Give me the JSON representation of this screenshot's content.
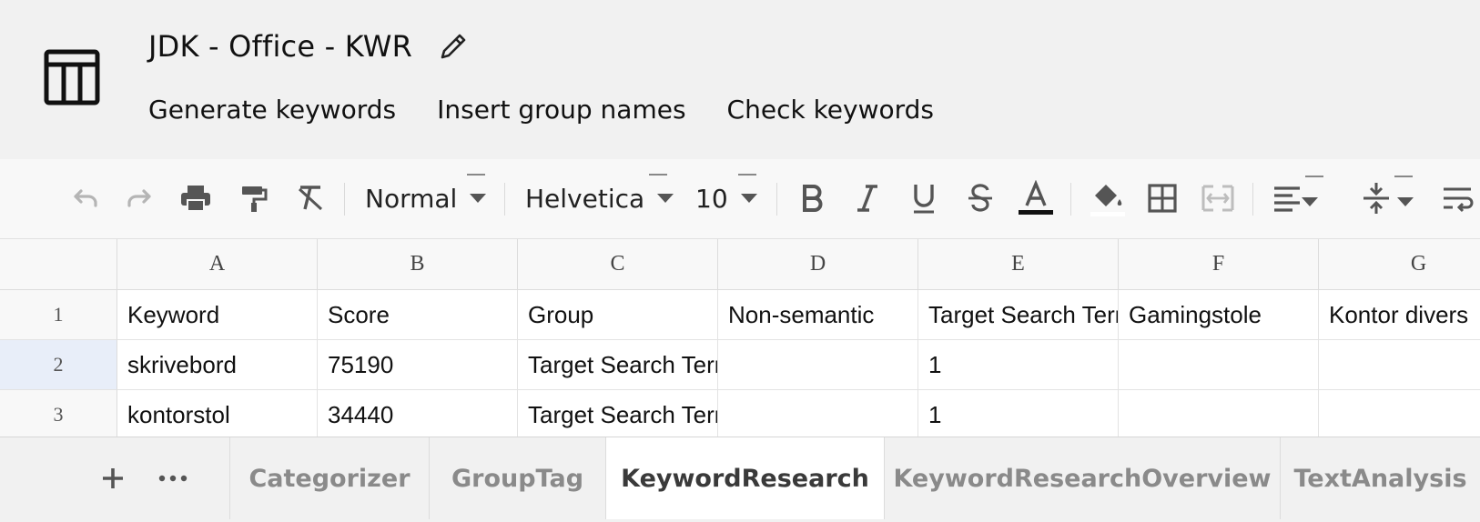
{
  "header": {
    "title": "JDK - Office - KWR",
    "menu": [
      "Generate keywords",
      "Insert group names",
      "Check keywords"
    ]
  },
  "toolbar": {
    "style": "Normal",
    "font": "Helvetica",
    "size": "10",
    "icons": [
      "undo-icon",
      "redo-icon",
      "print-icon",
      "paint-format-icon",
      "clear-format-icon",
      "bold-icon",
      "italic-icon",
      "underline-icon",
      "strikethrough-icon",
      "text-color-icon",
      "fill-color-icon",
      "borders-icon",
      "merge-cells-icon",
      "align-left-icon",
      "vertical-align-icon",
      "wrap-text-icon"
    ]
  },
  "grid": {
    "columns": [
      "A",
      "B",
      "C",
      "D",
      "E",
      "F",
      "G"
    ],
    "rows": [
      {
        "num": "1",
        "cells": [
          "Keyword",
          "Score",
          "Group",
          "Non-semantic",
          "Target Search Terms",
          "Gamingstole",
          "Kontor divers"
        ]
      },
      {
        "num": "2",
        "cells": [
          "skrivebord",
          "75190",
          "Target Search Terms",
          "",
          "1",
          "",
          ""
        ]
      },
      {
        "num": "3",
        "cells": [
          "kontorstol",
          "34440",
          "Target Search Terms",
          "",
          "1",
          "",
          ""
        ]
      }
    ]
  },
  "sheets": {
    "tabs": [
      "Categorizer",
      "GroupTag",
      "KeywordResearch",
      "KeywordResearchOverview",
      "TextAnalysis"
    ],
    "active": "KeywordResearch"
  },
  "colors": {
    "accent_active_row": "#e8eef9",
    "header_bg": "#f1f1f1"
  }
}
